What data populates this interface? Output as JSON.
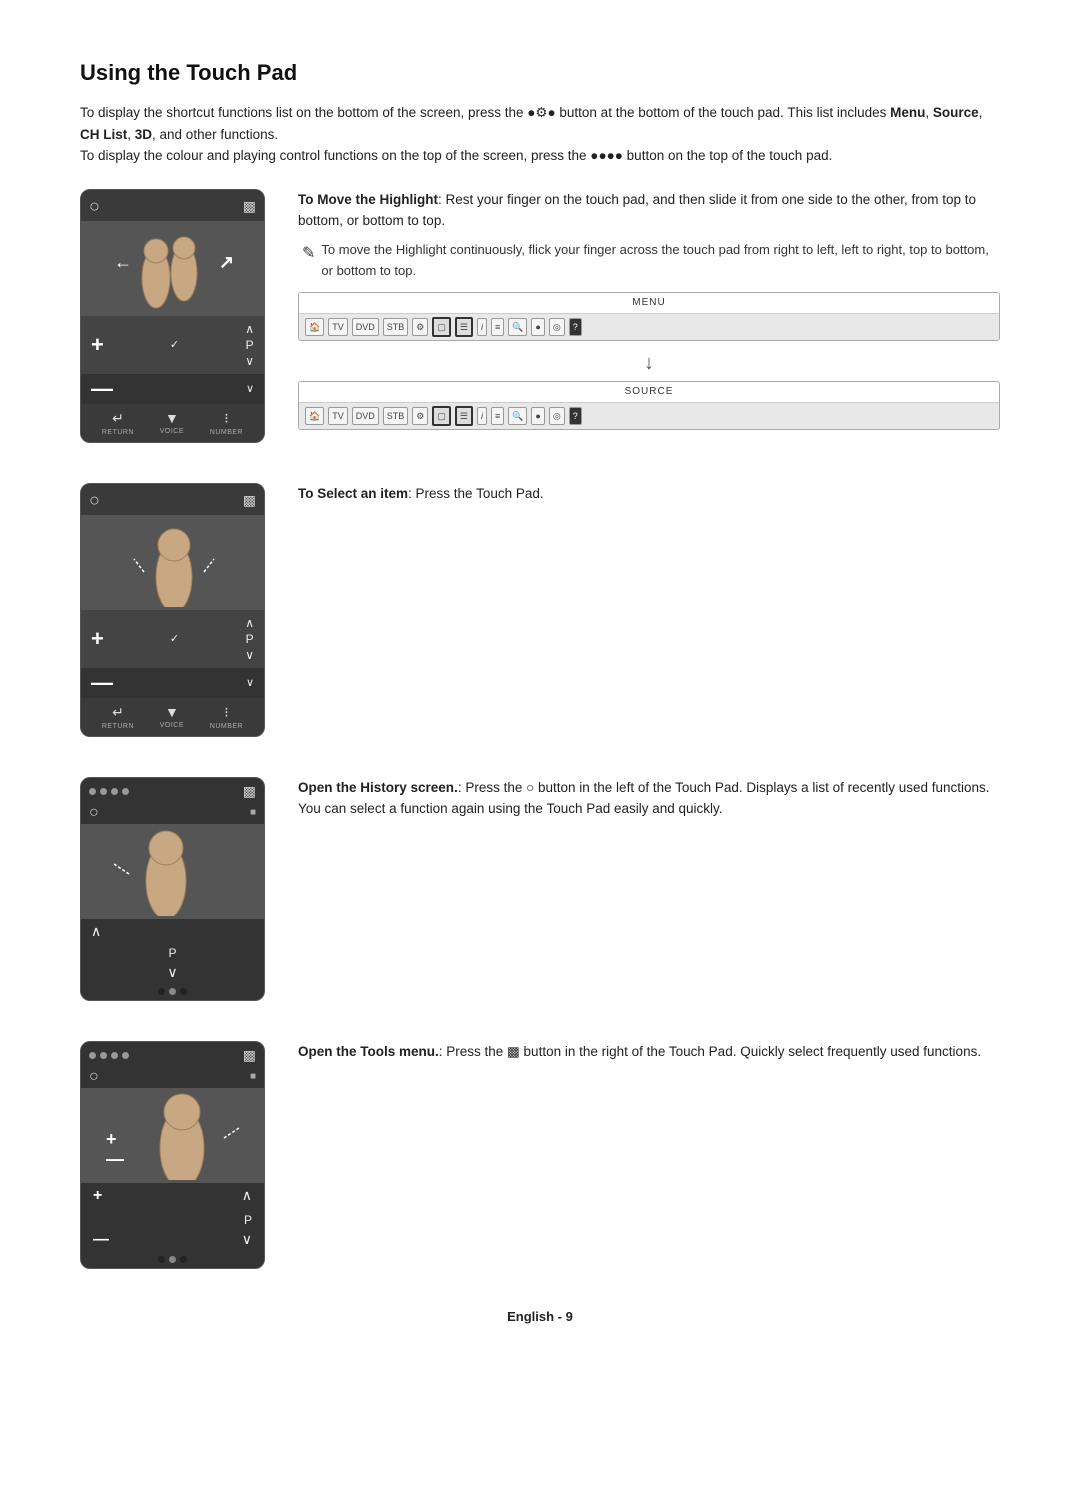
{
  "page": {
    "title": "Using the Touch Pad",
    "intro": [
      "To display the shortcut functions list on the bottom of the screen, press the ●✿● button at the bottom of the touch pad. This list includes Menu, Source, CH List, 3D, and other functions.",
      "To display the colour and playing control functions on the top of the screen, press the ●●●● button on the top of the touch pad."
    ],
    "sections": [
      {
        "id": "move-highlight",
        "heading": "To Move the Highlight",
        "heading_suffix": ": Rest your finger on the touch pad, and then slide it from one side to the other, from top to bottom, or bottom to top.",
        "note": "To move the Highlight continuously, flick your finger across the touch pad from right to left, left to right, top to bottom, or bottom to top.",
        "has_menu_bars": true
      },
      {
        "id": "select-item",
        "heading": "To Select an item",
        "heading_suffix": ": Press the Touch Pad.",
        "note": null,
        "has_menu_bars": false
      },
      {
        "id": "history-screen",
        "heading": "Open the History screen.",
        "heading_suffix": ": Press the ☺ button in the left of the Touch Pad. Displays a list of recently used functions. You can select a function again using the Touch Pad easily and quickly.",
        "note": null,
        "has_menu_bars": false
      },
      {
        "id": "tools-menu",
        "heading": "Open the Tools menu.",
        "heading_suffix": ": Press the ⊡ button in the right of the Touch Pad. Quickly select frequently used functions.",
        "note": null,
        "has_menu_bars": false
      }
    ],
    "menu_bar_labels": [
      "MENU",
      "SOURCE"
    ],
    "footer": "English - 9"
  }
}
